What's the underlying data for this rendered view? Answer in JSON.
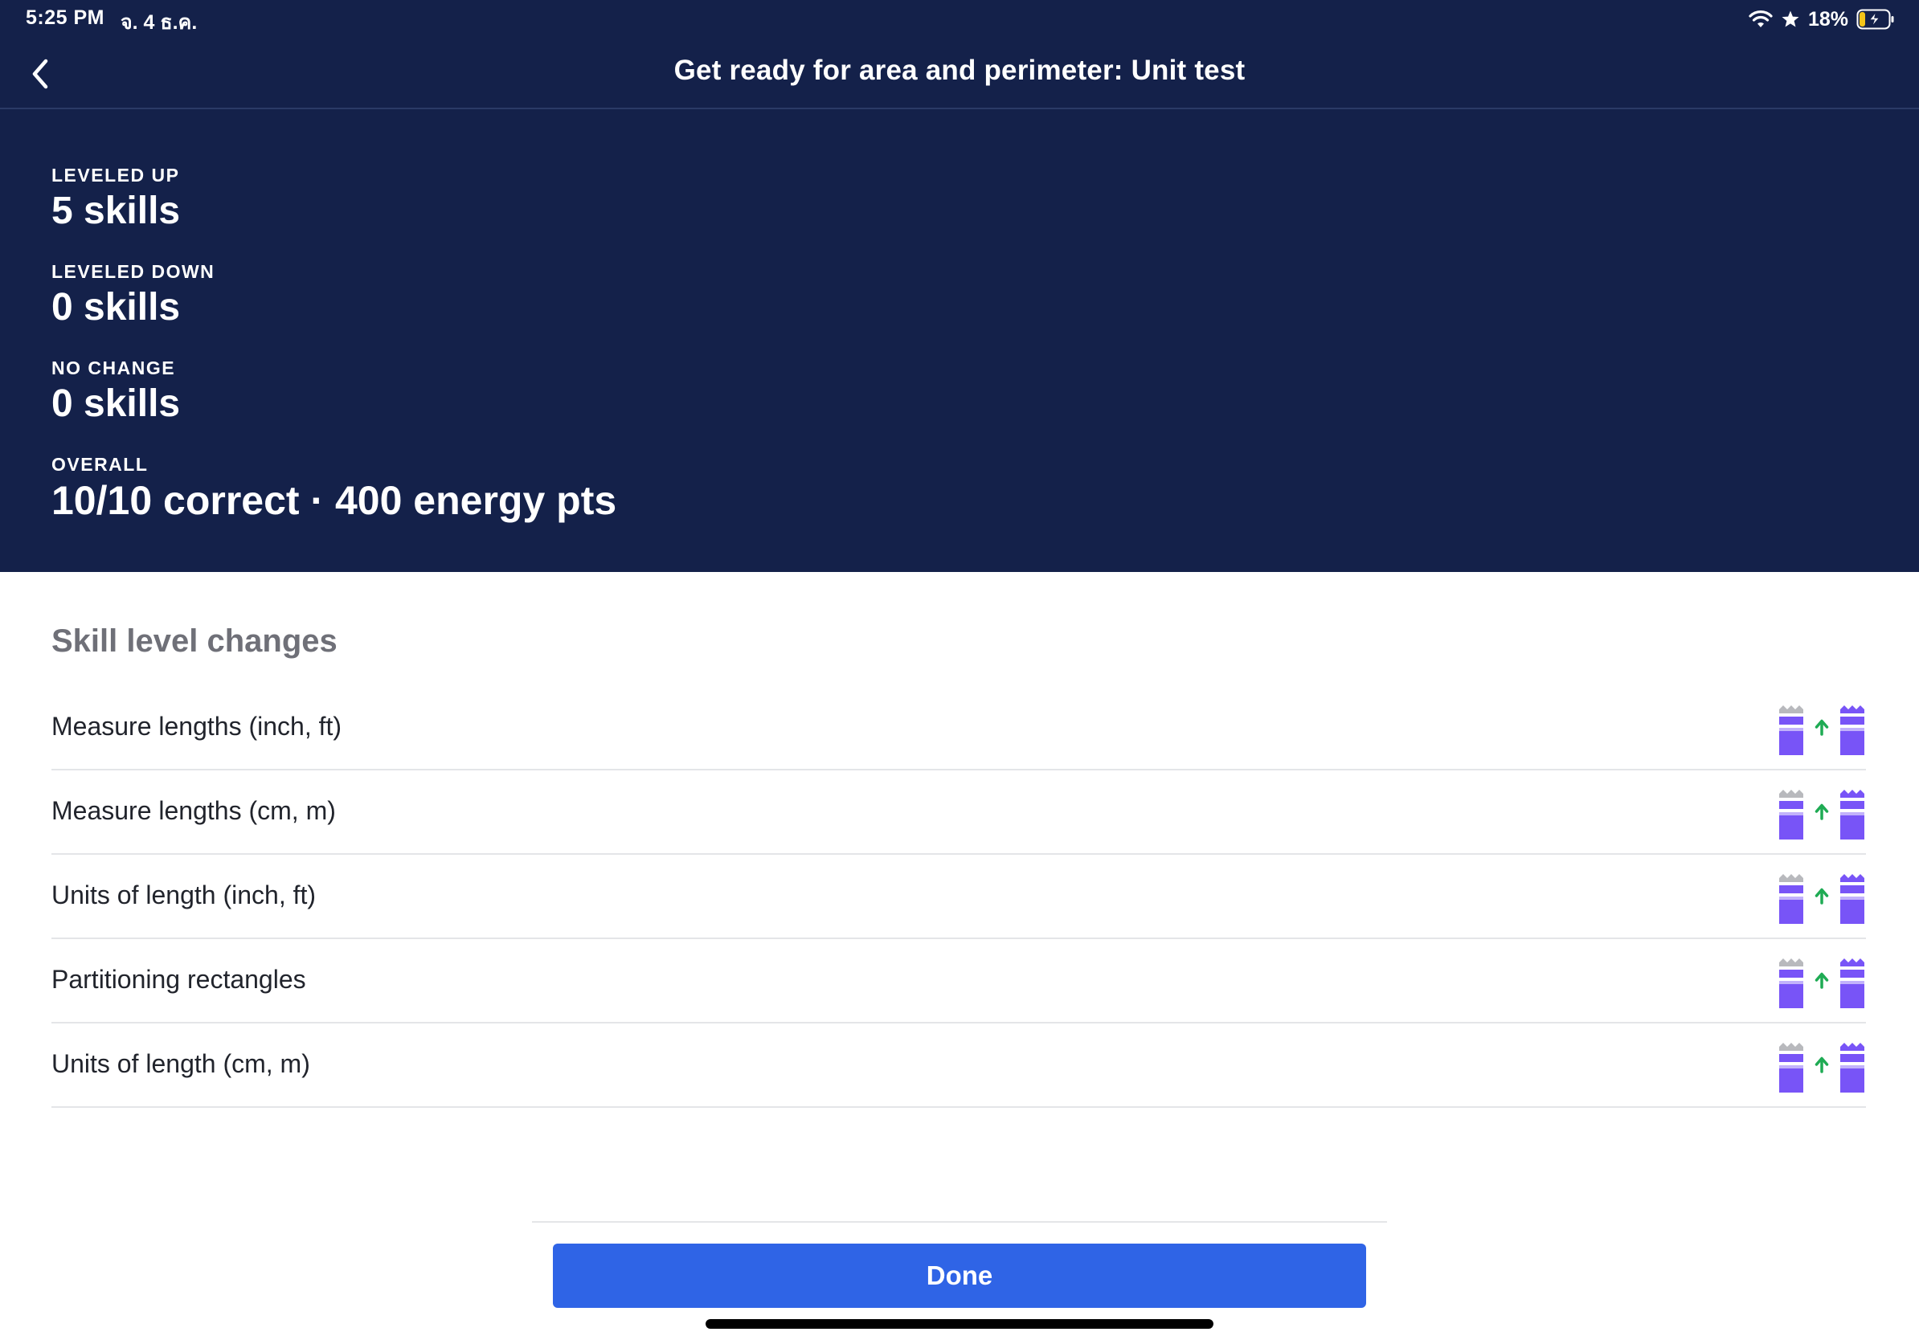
{
  "status_bar": {
    "time": "5:25 PM",
    "date": "จ. 4 ธ.ค.",
    "battery": "18%"
  },
  "nav": {
    "title": "Get ready for area and perimeter: Unit test",
    "back_icon": "chevron-left-icon"
  },
  "summary": {
    "leveled_up": {
      "label": "LEVELED UP",
      "value": "5 skills"
    },
    "leveled_down": {
      "label": "LEVELED DOWN",
      "value": "0 skills"
    },
    "no_change": {
      "label": "NO CHANGE",
      "value": "0 skills"
    },
    "overall": {
      "label": "OVERALL",
      "value": "10/10 correct · 400 energy pts"
    }
  },
  "skills_section": {
    "title": "Skill level changes",
    "items": [
      {
        "name": "Measure lengths (inch, ft)",
        "change": "up"
      },
      {
        "name": "Measure lengths (cm, m)",
        "change": "up"
      },
      {
        "name": "Units of length (inch, ft)",
        "change": "up"
      },
      {
        "name": "Partitioning rectangles",
        "change": "up"
      },
      {
        "name": "Units of length (cm, m)",
        "change": "up"
      }
    ]
  },
  "footer": {
    "done_label": "Done"
  },
  "colors": {
    "header_bg": "#14214a",
    "accent_blue": "#2f64e6",
    "mastery_purple": "#7854f7",
    "arrow_green": "#1fab54",
    "crown_gray": "#b8b9bd"
  }
}
